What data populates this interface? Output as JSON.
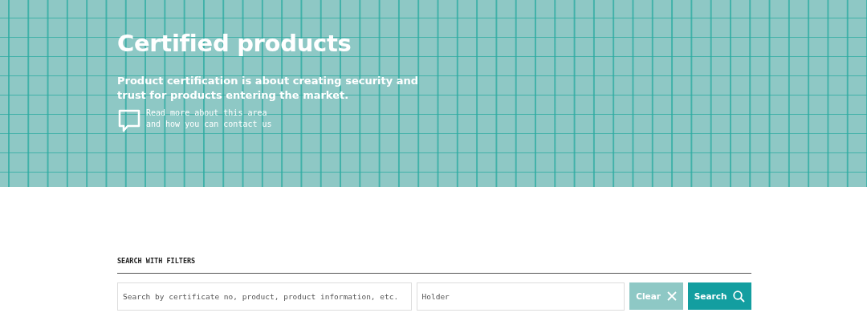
{
  "hero": {
    "title": "Certified products",
    "description": "Product certification is about creating security and trust for products entering the market.",
    "contact_link": [
      "Read more about this area",
      "and how you can contact us"
    ]
  },
  "search": {
    "heading": "SEARCH WITH FILTERS",
    "query_field": {
      "placeholder": "Search by certificate no, product, product information, etc."
    },
    "holder_field": {
      "placeholder": "Holder"
    },
    "clear_button": {
      "label": "Clear",
      "disabled": true
    },
    "search_button": {
      "label": "Search"
    }
  }
}
